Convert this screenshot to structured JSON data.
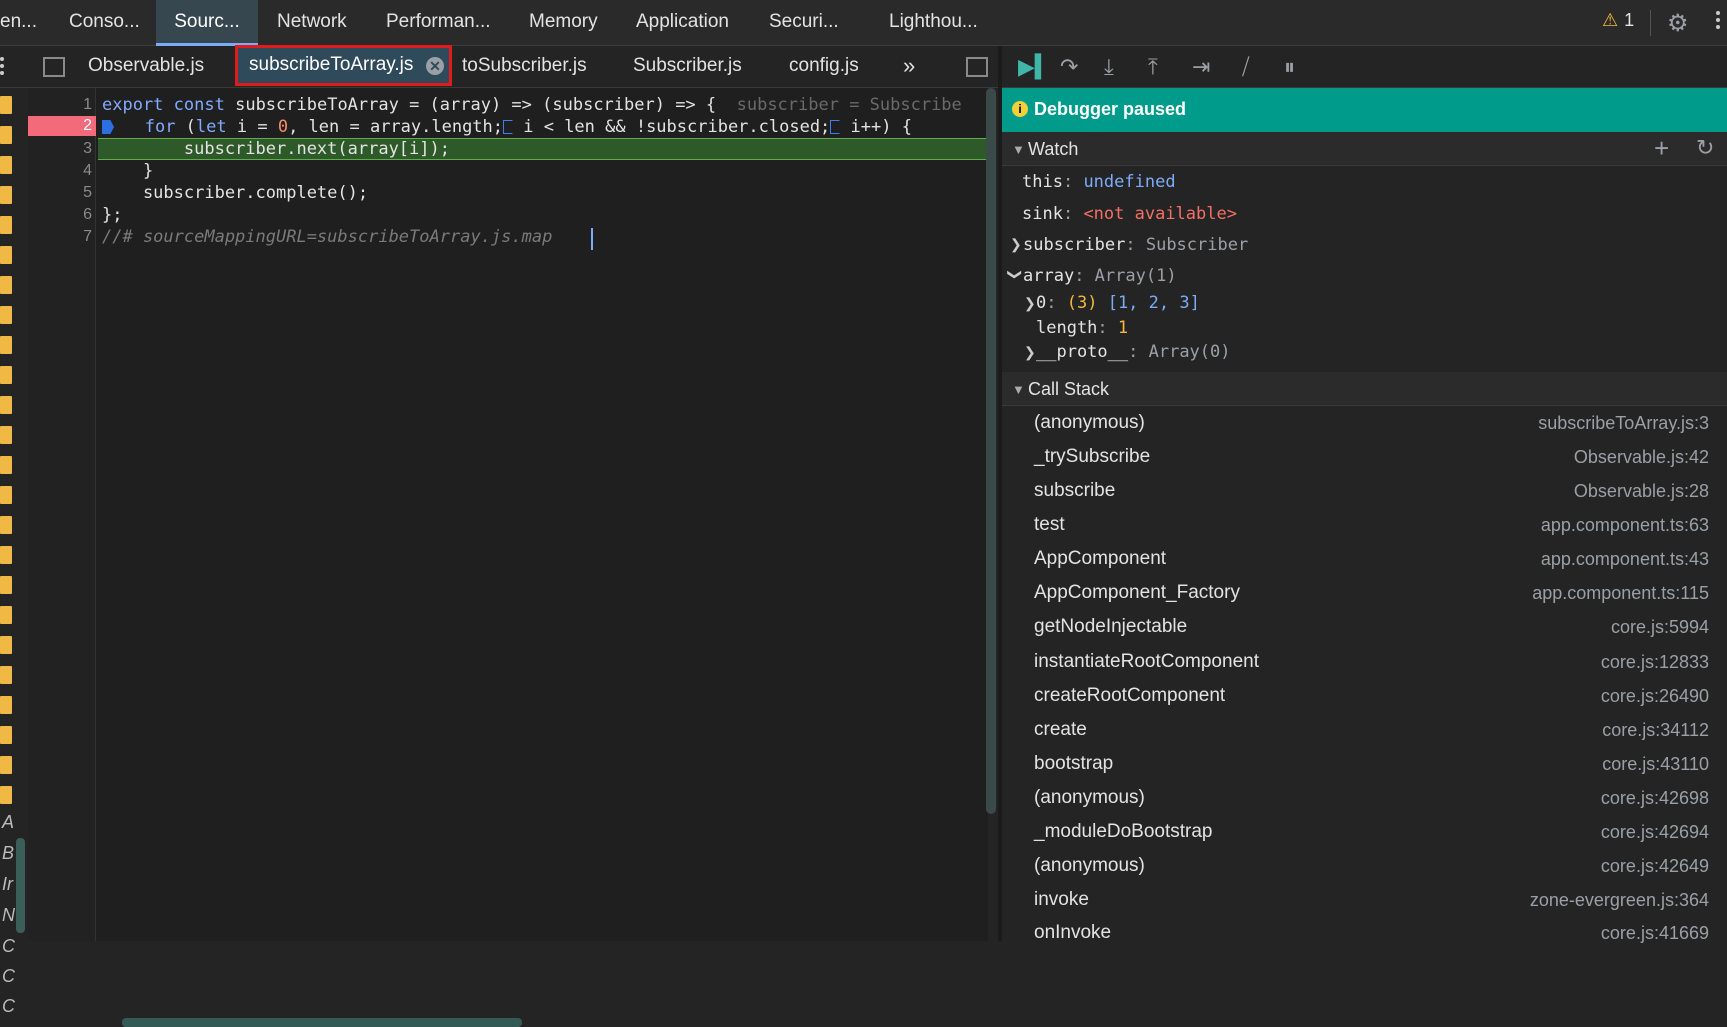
{
  "panel_tabs": [
    "en...",
    "Conso...",
    "Sourc...",
    "Network",
    "Performan...",
    "Memory",
    "Application",
    "Securi...",
    "Lighthou..."
  ],
  "active_panel": "Sourc...",
  "warnings_count": "1",
  "file_tabs": [
    "Observable.js",
    "subscribeToArray.js",
    "toSubscriber.js",
    "Subscriber.js",
    "config.js"
  ],
  "active_file": "subscribeToArray.js",
  "more_tabs_glyph": "»",
  "editor": {
    "line_numbers": [
      "1",
      "2",
      "3",
      "4",
      "5",
      "6",
      "7"
    ],
    "breakpoint_line": "2",
    "current_line": "3",
    "inline_hint": "subscriber = Subscribe",
    "source_map_comment": "//# sourceMappingURL=subscribeToArray.js.map"
  },
  "left_strip_letters": [
    "A",
    "B",
    "Ir",
    "N",
    "C",
    "C",
    "C"
  ],
  "debugger": {
    "status": "Debugger paused",
    "watch": {
      "title": "Watch",
      "items": [
        {
          "key": "this",
          "value": "undefined"
        },
        {
          "key": "sink",
          "value": "<not available>"
        },
        {
          "key": "subscriber",
          "value": "Subscriber"
        },
        {
          "key": "array",
          "value": "Array(1)"
        }
      ],
      "array_children": {
        "index_key": "0",
        "index_count": "(3)",
        "index_value": "[1, 2, 3]",
        "length_key": "length",
        "length_value": "1",
        "proto_key": "__proto__",
        "proto_value": "Array(0)"
      }
    },
    "call_stack": {
      "title": "Call Stack",
      "frames": [
        {
          "fn": "(anonymous)",
          "loc": "subscribeToArray.js:3"
        },
        {
          "fn": "_trySubscribe",
          "loc": "Observable.js:42"
        },
        {
          "fn": "subscribe",
          "loc": "Observable.js:28"
        },
        {
          "fn": "test",
          "loc": "app.component.ts:63"
        },
        {
          "fn": "AppComponent",
          "loc": "app.component.ts:43"
        },
        {
          "fn": "AppComponent_Factory",
          "loc": "app.component.ts:115"
        },
        {
          "fn": "getNodeInjectable",
          "loc": "core.js:5994"
        },
        {
          "fn": "instantiateRootComponent",
          "loc": "core.js:12833"
        },
        {
          "fn": "createRootComponent",
          "loc": "core.js:26490"
        },
        {
          "fn": "create",
          "loc": "core.js:34112"
        },
        {
          "fn": "bootstrap",
          "loc": "core.js:43110"
        },
        {
          "fn": "(anonymous)",
          "loc": "core.js:42698"
        },
        {
          "fn": "_moduleDoBootstrap",
          "loc": "core.js:42694"
        },
        {
          "fn": "(anonymous)",
          "loc": "core.js:42649"
        },
        {
          "fn": "invoke",
          "loc": "zone-evergreen.js:364"
        },
        {
          "fn": "onInvoke",
          "loc": "core.js:41669"
        }
      ]
    }
  },
  "colors": {
    "accent": "#7cacf8",
    "paused_banner": "#009b8b",
    "breakpoint": "#f36a7a",
    "exec_line": "#2e5a2a",
    "selected_tab_border": "#e01b1b"
  }
}
